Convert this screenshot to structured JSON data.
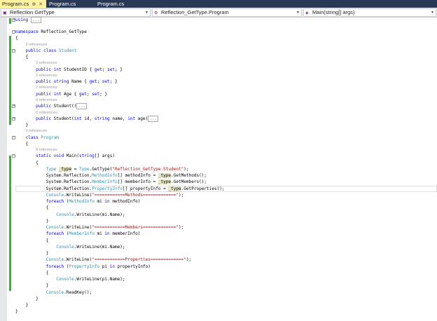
{
  "tabs": [
    {
      "label": "Program.cs",
      "active": true
    },
    {
      "label": "Program.cs"
    },
    {
      "label": "Program.cs"
    }
  ],
  "nav": {
    "project": "Reflection GetType",
    "class": "Reflection_GetType.Program",
    "member": "Main(string[] args)"
  },
  "lines": [
    {
      "fold": "plus",
      "tokens": [
        {
          "c": "k",
          "t": "using"
        },
        {
          "c": "p",
          "t": " "
        },
        {
          "c": "box",
          "t": "..."
        }
      ]
    },
    {
      "blank": true
    },
    {
      "fold": "minus",
      "tokens": [
        {
          "c": "k",
          "t": "namespace"
        },
        {
          "c": "p",
          "t": " Reflection_GetType"
        }
      ]
    },
    {
      "tokens": [
        {
          "c": "p",
          "t": "{"
        }
      ]
    },
    {
      "ref": true,
      "indent": 1,
      "tokens": [
        {
          "c": "r",
          "t": "2 references"
        }
      ]
    },
    {
      "fold": "minus",
      "indent": 1,
      "tokens": [
        {
          "c": "k",
          "t": "public class"
        },
        {
          "c": "p",
          "t": " "
        },
        {
          "c": "t",
          "t": "Student"
        }
      ]
    },
    {
      "indent": 1,
      "tokens": [
        {
          "c": "p",
          "t": "{"
        }
      ]
    },
    {
      "ref": true,
      "indent": 2,
      "tokens": [
        {
          "c": "r",
          "t": "2 references"
        }
      ]
    },
    {
      "indent": 2,
      "tokens": [
        {
          "c": "k",
          "t": "public int"
        },
        {
          "c": "p",
          "t": " StudentID { "
        },
        {
          "c": "k",
          "t": "get"
        },
        {
          "c": "p",
          "t": "; "
        },
        {
          "c": "k",
          "t": "set"
        },
        {
          "c": "p",
          "t": "; }"
        }
      ]
    },
    {
      "ref": true,
      "indent": 2,
      "tokens": [
        {
          "c": "r",
          "t": "2 references"
        }
      ]
    },
    {
      "indent": 2,
      "tokens": [
        {
          "c": "k",
          "t": "public string"
        },
        {
          "c": "p",
          "t": " Name { "
        },
        {
          "c": "k",
          "t": "get"
        },
        {
          "c": "p",
          "t": "; "
        },
        {
          "c": "k",
          "t": "set"
        },
        {
          "c": "p",
          "t": "; }"
        }
      ]
    },
    {
      "ref": true,
      "indent": 2,
      "tokens": [
        {
          "c": "r",
          "t": "2 references"
        }
      ]
    },
    {
      "indent": 2,
      "tokens": [
        {
          "c": "k",
          "t": "public int"
        },
        {
          "c": "p",
          "t": " Age { "
        },
        {
          "c": "k",
          "t": "get"
        },
        {
          "c": "p",
          "t": "; "
        },
        {
          "c": "k",
          "t": "set"
        },
        {
          "c": "p",
          "t": "; }"
        }
      ]
    },
    {
      "ref": true,
      "indent": 2,
      "tokens": [
        {
          "c": "r",
          "t": "0 references"
        }
      ]
    },
    {
      "fold": "plus",
      "indent": 2,
      "tokens": [
        {
          "c": "k",
          "t": "public"
        },
        {
          "c": "p",
          "t": " Student()"
        },
        {
          "c": "box",
          "t": "..."
        }
      ]
    },
    {
      "ref": true,
      "indent": 2,
      "tokens": [
        {
          "c": "r",
          "t": "0 references"
        }
      ]
    },
    {
      "fold": "plus",
      "indent": 2,
      "tokens": [
        {
          "c": "k",
          "t": "public"
        },
        {
          "c": "p",
          "t": " Student("
        },
        {
          "c": "k",
          "t": "int"
        },
        {
          "c": "p",
          "t": " id, "
        },
        {
          "c": "k",
          "t": "string"
        },
        {
          "c": "p",
          "t": " name, "
        },
        {
          "c": "k",
          "t": "int"
        },
        {
          "c": "p",
          "t": " age)"
        },
        {
          "c": "box",
          "t": "..."
        }
      ]
    },
    {
      "indent": 1,
      "tokens": [
        {
          "c": "p",
          "t": "}"
        }
      ]
    },
    {
      "ref": true,
      "indent": 1,
      "tokens": [
        {
          "c": "r",
          "t": "0 references"
        }
      ]
    },
    {
      "fold": "minus",
      "indent": 1,
      "tokens": [
        {
          "c": "k",
          "t": "class"
        },
        {
          "c": "p",
          "t": " "
        },
        {
          "c": "t",
          "t": "Program"
        }
      ]
    },
    {
      "indent": 1,
      "tokens": [
        {
          "c": "p",
          "t": "{"
        }
      ]
    },
    {
      "ref": true,
      "indent": 2,
      "tokens": [
        {
          "c": "r",
          "t": "0 references"
        }
      ]
    },
    {
      "fold": "minus",
      "indent": 2,
      "tokens": [
        {
          "c": "k",
          "t": "static void"
        },
        {
          "c": "p",
          "t": " Main("
        },
        {
          "c": "k",
          "t": "string"
        },
        {
          "c": "p",
          "t": "[] args)"
        }
      ]
    },
    {
      "indent": 2,
      "tokens": [
        {
          "c": "p",
          "t": "{"
        }
      ]
    },
    {
      "indent": 3,
      "tokens": [
        {
          "c": "t",
          "t": "Type"
        },
        {
          "c": "p",
          "t": " "
        },
        {
          "c": "h",
          "t": "_type"
        },
        {
          "c": "p",
          "t": " = "
        },
        {
          "c": "t",
          "t": "Type"
        },
        {
          "c": "p",
          "t": ".GetType("
        },
        {
          "c": "s",
          "t": "\"Reflection_GetType.Student\""
        },
        {
          "c": "p",
          "t": ");"
        }
      ]
    },
    {
      "indent": 3,
      "tokens": [
        {
          "c": "p",
          "t": "System.Reflection."
        },
        {
          "c": "t",
          "t": "MethodInfo"
        },
        {
          "c": "p",
          "t": "[] methodInfo = "
        },
        {
          "c": "h",
          "t": "_type"
        },
        {
          "c": "p",
          "t": ".GetMethods();"
        }
      ]
    },
    {
      "indent": 3,
      "tokens": [
        {
          "c": "p",
          "t": "System.Reflection."
        },
        {
          "c": "t",
          "t": "MemberInfo"
        },
        {
          "c": "p",
          "t": "[] memberInfo = "
        },
        {
          "c": "h",
          "t": "_type"
        },
        {
          "c": "p",
          "t": ".GetMembers();"
        }
      ]
    },
    {
      "current": true,
      "indent": 3,
      "tokens": [
        {
          "c": "p",
          "t": "System.Reflection."
        },
        {
          "c": "t",
          "t": "PropertyInfo"
        },
        {
          "c": "p",
          "t": "[] propertyInfo = "
        },
        {
          "c": "h",
          "t": "_type"
        },
        {
          "c": "p",
          "t": ".GetProperties();"
        }
      ]
    },
    {
      "indent": 3,
      "tokens": [
        {
          "c": "t",
          "t": "Console"
        },
        {
          "c": "p",
          "t": ".WriteLine("
        },
        {
          "c": "s",
          "t": "\"============Methods=============\""
        },
        {
          "c": "p",
          "t": ");"
        }
      ]
    },
    {
      "indent": 3,
      "tokens": [
        {
          "c": "k",
          "t": "foreach"
        },
        {
          "c": "p",
          "t": " ("
        },
        {
          "c": "t",
          "t": "MethodInfo"
        },
        {
          "c": "p",
          "t": " mi "
        },
        {
          "c": "k",
          "t": "in"
        },
        {
          "c": "p",
          "t": " methodInfo)"
        }
      ]
    },
    {
      "indent": 3,
      "tokens": [
        {
          "c": "p",
          "t": "{"
        }
      ]
    },
    {
      "indent": 4,
      "tokens": [
        {
          "c": "t",
          "t": "Console"
        },
        {
          "c": "p",
          "t": ".WriteLine(mi.Name);"
        }
      ]
    },
    {
      "indent": 3,
      "tokens": [
        {
          "c": "p",
          "t": "}"
        }
      ]
    },
    {
      "indent": 3,
      "tokens": [
        {
          "c": "t",
          "t": "Console"
        },
        {
          "c": "p",
          "t": ".WriteLine("
        },
        {
          "c": "s",
          "t": "\"============Members=============\""
        },
        {
          "c": "p",
          "t": ");"
        }
      ]
    },
    {
      "indent": 3,
      "tokens": [
        {
          "c": "k",
          "t": "foreach"
        },
        {
          "c": "p",
          "t": " ("
        },
        {
          "c": "t",
          "t": "MemberInfo"
        },
        {
          "c": "p",
          "t": " mi "
        },
        {
          "c": "k",
          "t": "in"
        },
        {
          "c": "p",
          "t": " memberInfo)"
        }
      ]
    },
    {
      "indent": 3,
      "tokens": [
        {
          "c": "p",
          "t": "{"
        }
      ]
    },
    {
      "indent": 4,
      "tokens": [
        {
          "c": "t",
          "t": "Console"
        },
        {
          "c": "p",
          "t": ".WriteLine(mi.Name);"
        }
      ]
    },
    {
      "indent": 3,
      "tokens": [
        {
          "c": "p",
          "t": "}"
        }
      ]
    },
    {
      "indent": 3,
      "tokens": [
        {
          "c": "t",
          "t": "Console"
        },
        {
          "c": "p",
          "t": ".WriteLine("
        },
        {
          "c": "s",
          "t": "\"============Properties=============\""
        },
        {
          "c": "p",
          "t": ");"
        }
      ]
    },
    {
      "indent": 3,
      "tokens": [
        {
          "c": "k",
          "t": "foreach"
        },
        {
          "c": "p",
          "t": " ("
        },
        {
          "c": "t",
          "t": "PropertyInfo"
        },
        {
          "c": "p",
          "t": " pi "
        },
        {
          "c": "k",
          "t": "in"
        },
        {
          "c": "p",
          "t": " propertyInfo)"
        }
      ]
    },
    {
      "indent": 3,
      "tokens": [
        {
          "c": "p",
          "t": "{"
        }
      ]
    },
    {
      "indent": 4,
      "tokens": [
        {
          "c": "t",
          "t": "Console"
        },
        {
          "c": "p",
          "t": ".WriteLine(pi.Name);"
        }
      ]
    },
    {
      "indent": 3,
      "tokens": [
        {
          "c": "p",
          "t": "}"
        }
      ]
    },
    {
      "indent": 3,
      "tokens": [
        {
          "c": "t",
          "t": "Console"
        },
        {
          "c": "p",
          "t": ".ReadKey();"
        }
      ]
    },
    {
      "indent": 2,
      "tokens": [
        {
          "c": "p",
          "t": "}"
        }
      ]
    },
    {
      "indent": 1,
      "tokens": [
        {
          "c": "p",
          "t": "}"
        }
      ]
    },
    {
      "tokens": [
        {
          "c": "p",
          "t": "}"
        }
      ]
    }
  ]
}
